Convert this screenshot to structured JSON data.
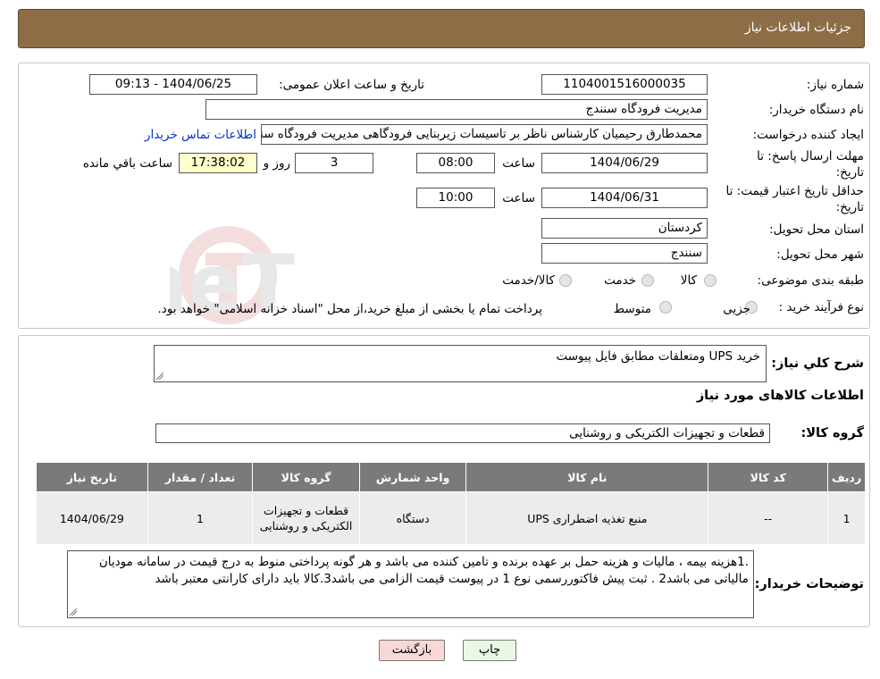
{
  "header": {
    "title": "جزئیات اطلاعات نیاز"
  },
  "watermark": {
    "text": "AriaTender.neT"
  },
  "fields": {
    "need_number_label": "شماره نیاز:",
    "need_number": "1104001516000035",
    "announce_label": "تاریخ و ساعت اعلان عمومی:",
    "announce_value": "1404/06/25 - 09:13",
    "buyer_org_label": "نام دستگاه خریدار:",
    "buyer_org": "مدیریت فرودگاه سنندج",
    "creator_label": "ایجاد کننده درخواست:",
    "creator": "محمدطارق رحیمیان کارشناس ناظر بر تاسیسات زیربنایی فرودگاهی مدیریت فرودگاه سنندج",
    "contact_link": "اطلاعات تماس خریدار",
    "deadline_label_1": "مهلت ارسال پاسخ: تا",
    "deadline_label_2": "تاریخ:",
    "deadline_date": "1404/06/29",
    "time_label": "ساعت",
    "deadline_time": "08:00",
    "days_count": "3",
    "days_label": "روز و",
    "remaining_time": "17:38:02",
    "remaining_label": "ساعت باقي مانده",
    "validity_label_1": "حداقل تاریخ اعتبار قیمت: تا",
    "validity_label_2": "تاریخ:",
    "validity_date": "1404/06/31",
    "validity_time": "10:00",
    "province_label": "استان محل تحویل:",
    "province": "کردستان",
    "city_label": "شهر محل تحویل:",
    "city": "سنندج",
    "category_label": "طبقه بندی موضوعی:",
    "category_options": [
      "کالا",
      "خدمت",
      "کالا/خدمت"
    ],
    "process_label": "نوع فرآیند خرید :",
    "process_options": [
      "جزیی",
      "متوسط"
    ],
    "process_note": "پرداخت تمام یا بخشی از مبلغ خرید،از محل \"اسناد خزانه اسلامی\" خواهد بود."
  },
  "description": {
    "label": "شرح کلي نیاز:",
    "value": "خرید UPS ومتعلقات مطابق فایل پیوست",
    "goods_info_title": "اطلاعات کالاهای مورد نیاز",
    "group_label": "گروه کالا:",
    "group_value": "قطعات و تجهیزات الکتریکی و روشنایی"
  },
  "table": {
    "headers": [
      "ردیف",
      "کد کالا",
      "نام کالا",
      "واحد شمارش",
      "گروه کالا",
      "تعداد / مقدار",
      "تاریخ نیاز"
    ],
    "rows": [
      [
        "1",
        "--",
        "منبع تغذیه اضطراری UPS",
        "دستگاه",
        "قطعات و تجهیزات الکتریکی و روشنایی",
        "1",
        "1404/06/29"
      ]
    ]
  },
  "notes": {
    "label": "توضیحات خریدار:",
    "value": ".1هزینه بیمه ، مالیات و هزینه حمل بر عهده  برنده و تامین کننده می باشد و هر گونه پرداختی منوط به درج قیمت در سامانه مودیان مالیاتی می باشد2 . ثبت پیش فاکتوررسمی نوع 1 در پیوست قیمت الزامی می باشد3.کالا باید دارای کارانتی معتبر باشد"
  },
  "buttons": {
    "print": "چاپ",
    "back": "بازگشت"
  },
  "colors": {
    "header": "#8c6d45",
    "table_header": "#7a7a7a",
    "back_button": "#f8d7d7",
    "print_button": "#eaf7e4",
    "countdown": "#ffffcc",
    "link": "#0033cc"
  }
}
